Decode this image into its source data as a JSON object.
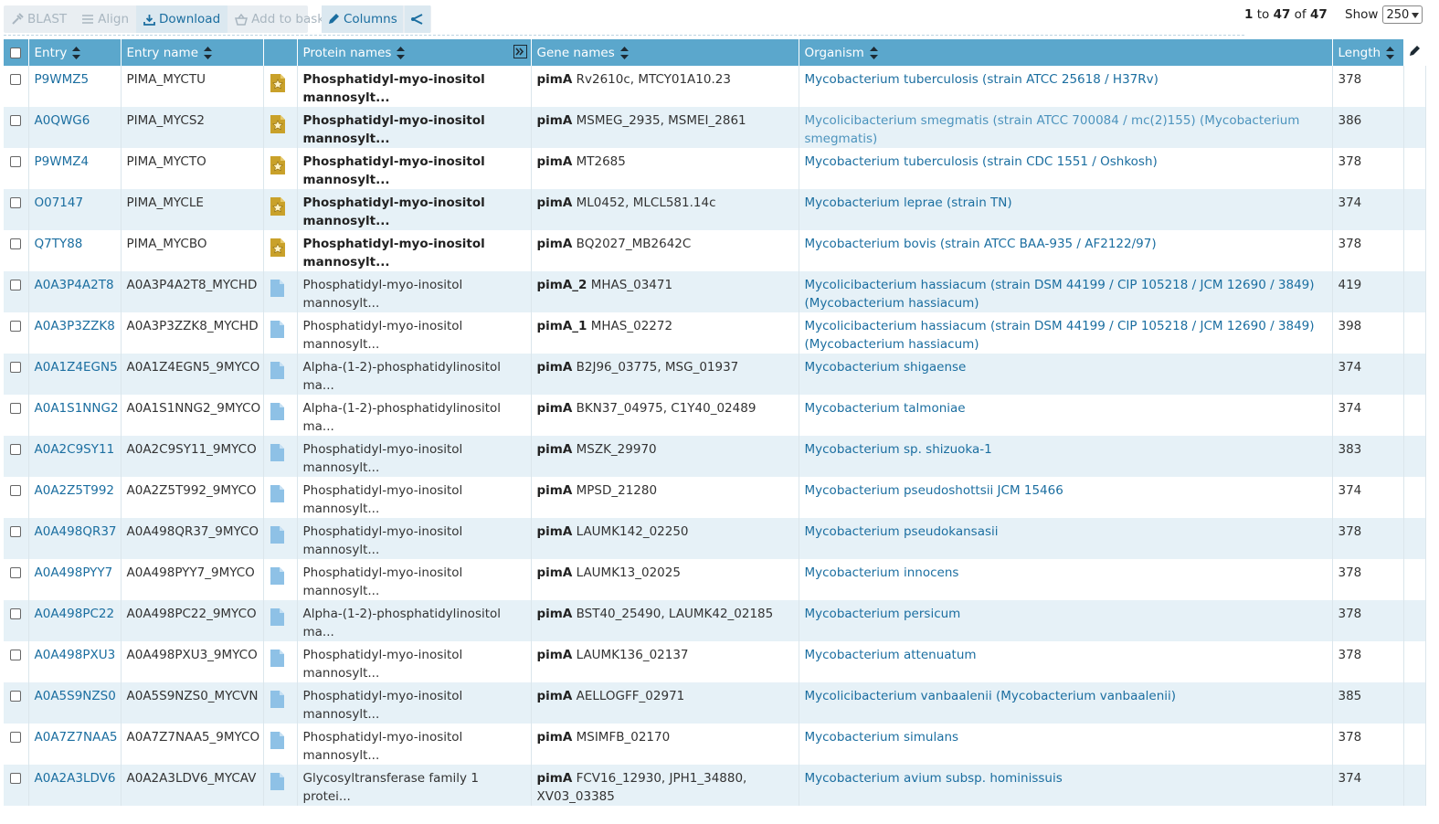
{
  "toolbar": {
    "blast_label": "BLAST",
    "align_label": "Align",
    "download_label": "Download",
    "basket_label": "Add to basket",
    "columns_label": "Columns"
  },
  "pager": {
    "start": "1",
    "to_word": "to",
    "end": "47",
    "of_word": "of",
    "total": "47"
  },
  "show": {
    "label": "Show",
    "value": "250"
  },
  "columns": {
    "entry": "Entry",
    "entry_name": "Entry name",
    "protein_names": "Protein names",
    "gene_names": "Gene names",
    "organism": "Organism",
    "length": "Length"
  },
  "colors": {
    "header": "#5ba7cc",
    "link": "#1b6ea0",
    "reviewed": "#c9a12a",
    "unreviewed": "#7fb6dc",
    "row_alt": "#e6f1f7"
  },
  "rows": [
    {
      "entry": "P9WMZ5",
      "entry_name": "PIMA_MYCTU",
      "status": "reviewed",
      "protein": "Phosphatidyl-myo-inositol mannosylt...",
      "gene_bold": "pimA",
      "gene_rest": "Rv2610c, MTCY01A10.23",
      "organism": "Mycobacterium tuberculosis (strain ATCC 25618 / H37Rv)",
      "length": "378"
    },
    {
      "entry": "A0QWG6",
      "entry_name": "PIMA_MYCS2",
      "status": "reviewed",
      "protein": "Phosphatidyl-myo-inositol mannosylt...",
      "gene_bold": "pimA",
      "gene_rest": "MSMEG_2935, MSMEI_2861",
      "organism": "Mycolicibacterium smegmatis (strain ATCC 700084 / mc(2)155) (Mycobacterium smegmatis)",
      "length": "386"
    },
    {
      "entry": "P9WMZ4",
      "entry_name": "PIMA_MYCTO",
      "status": "reviewed",
      "protein": "Phosphatidyl-myo-inositol mannosylt...",
      "gene_bold": "pimA",
      "gene_rest": "MT2685",
      "organism": "Mycobacterium tuberculosis (strain CDC 1551 / Oshkosh)",
      "length": "378"
    },
    {
      "entry": "O07147",
      "entry_name": "PIMA_MYCLE",
      "status": "reviewed",
      "protein": "Phosphatidyl-myo-inositol mannosylt...",
      "gene_bold": "pimA",
      "gene_rest": "ML0452, MLCL581.14c",
      "organism": "Mycobacterium leprae (strain TN)",
      "length": "374"
    },
    {
      "entry": "Q7TY88",
      "entry_name": "PIMA_MYCBO",
      "status": "reviewed",
      "protein": "Phosphatidyl-myo-inositol mannosylt...",
      "gene_bold": "pimA",
      "gene_rest": "BQ2027_MB2642C",
      "organism": "Mycobacterium bovis (strain ATCC BAA-935 / AF2122/97)",
      "length": "378"
    },
    {
      "entry": "A0A3P4A2T8",
      "entry_name": "A0A3P4A2T8_MYCHD",
      "status": "unreviewed",
      "protein": "Phosphatidyl-myo-inositol mannosylt...",
      "gene_bold": "pimA_2",
      "gene_rest": "MHAS_03471",
      "organism": "Mycolicibacterium hassiacum (strain DSM 44199 / CIP 105218 / JCM 12690 / 3849) (Mycobacterium hassiacum)",
      "length": "419"
    },
    {
      "entry": "A0A3P3ZZK8",
      "entry_name": "A0A3P3ZZK8_MYCHD",
      "status": "unreviewed",
      "protein": "Phosphatidyl-myo-inositol mannosylt...",
      "gene_bold": "pimA_1",
      "gene_rest": "MHAS_02272",
      "organism": "Mycolicibacterium hassiacum (strain DSM 44199 / CIP 105218 / JCM 12690 / 3849) (Mycobacterium hassiacum)",
      "length": "398"
    },
    {
      "entry": "A0A1Z4EGN5",
      "entry_name": "A0A1Z4EGN5_9MYCO",
      "status": "unreviewed",
      "protein": "Alpha-(1-2)-phosphatidylinositol ma...",
      "gene_bold": "pimA",
      "gene_rest": "B2J96_03775, MSG_01937",
      "organism": "Mycobacterium shigaense",
      "length": "374"
    },
    {
      "entry": "A0A1S1NNG2",
      "entry_name": "A0A1S1NNG2_9MYCO",
      "status": "unreviewed",
      "protein": "Alpha-(1-2)-phosphatidylinositol ma...",
      "gene_bold": "pimA",
      "gene_rest": "BKN37_04975, C1Y40_02489",
      "organism": "Mycobacterium talmoniae",
      "length": "374"
    },
    {
      "entry": "A0A2C9SY11",
      "entry_name": "A0A2C9SY11_9MYCO",
      "status": "unreviewed",
      "protein": "Phosphatidyl-myo-inositol mannosylt...",
      "gene_bold": "pimA",
      "gene_rest": "MSZK_29970",
      "organism": "Mycobacterium sp. shizuoka-1",
      "length": "383"
    },
    {
      "entry": "A0A2Z5T992",
      "entry_name": "A0A2Z5T992_9MYCO",
      "status": "unreviewed",
      "protein": "Phosphatidyl-myo-inositol mannosylt...",
      "gene_bold": "pimA",
      "gene_rest": "MPSD_21280",
      "organism": "Mycobacterium pseudoshottsii JCM 15466",
      "length": "374"
    },
    {
      "entry": "A0A498QR37",
      "entry_name": "A0A498QR37_9MYCO",
      "status": "unreviewed",
      "protein": "Phosphatidyl-myo-inositol mannosylt...",
      "gene_bold": "pimA",
      "gene_rest": "LAUMK142_02250",
      "organism": "Mycobacterium pseudokansasii",
      "length": "378"
    },
    {
      "entry": "A0A498PYY7",
      "entry_name": "A0A498PYY7_9MYCO",
      "status": "unreviewed",
      "protein": "Phosphatidyl-myo-inositol mannosylt...",
      "gene_bold": "pimA",
      "gene_rest": "LAUMK13_02025",
      "organism": "Mycobacterium innocens",
      "length": "378"
    },
    {
      "entry": "A0A498PC22",
      "entry_name": "A0A498PC22_9MYCO",
      "status": "unreviewed",
      "protein": "Alpha-(1-2)-phosphatidylinositol ma...",
      "gene_bold": "pimA",
      "gene_rest": "BST40_25490, LAUMK42_02185",
      "organism": "Mycobacterium persicum",
      "length": "378"
    },
    {
      "entry": "A0A498PXU3",
      "entry_name": "A0A498PXU3_9MYCO",
      "status": "unreviewed",
      "protein": "Phosphatidyl-myo-inositol mannosylt...",
      "gene_bold": "pimA",
      "gene_rest": "LAUMK136_02137",
      "organism": "Mycobacterium attenuatum",
      "length": "378"
    },
    {
      "entry": "A0A5S9NZS0",
      "entry_name": "A0A5S9NZS0_MYCVN",
      "status": "unreviewed",
      "protein": "Phosphatidyl-myo-inositol mannosylt...",
      "gene_bold": "pimA",
      "gene_rest": "AELLOGFF_02971",
      "organism": "Mycolicibacterium vanbaalenii (Mycobacterium vanbaalenii)",
      "length": "385"
    },
    {
      "entry": "A0A7Z7NAA5",
      "entry_name": "A0A7Z7NAA5_9MYCO",
      "status": "unreviewed",
      "protein": "Phosphatidyl-myo-inositol mannosylt...",
      "gene_bold": "pimA",
      "gene_rest": "MSIMFB_02170",
      "organism": "Mycobacterium simulans",
      "length": "378"
    },
    {
      "entry": "A0A2A3LDV6",
      "entry_name": "A0A2A3LDV6_MYCAV",
      "status": "unreviewed",
      "protein": "Glycosyltransferase family 1 protei...",
      "gene_bold": "pimA",
      "gene_rest": "FCV16_12930, JPH1_34880, XV03_03385",
      "organism": "Mycobacterium avium subsp. hominissuis",
      "length": "374"
    }
  ]
}
